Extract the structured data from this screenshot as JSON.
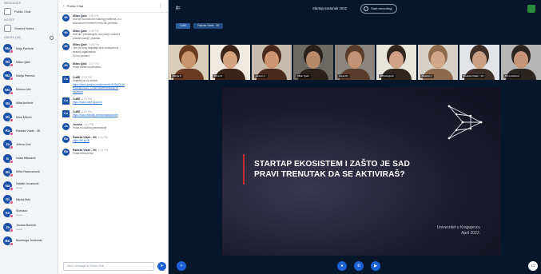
{
  "left_panel": {
    "section_messages": "MESSAGES",
    "public_chat_label": "Public Chat",
    "section_notes": "NOTES",
    "shared_notes_label": "Shared Notes",
    "section_users": "USERS (48)",
    "users": [
      {
        "initials": "Ma",
        "name": "Maja Pavlović",
        "sub": ""
      },
      {
        "initials": "Mi",
        "name": "Milan Qalić",
        "sub": ""
      },
      {
        "initials": "Ma",
        "name": "Marija Petrović",
        "sub": ""
      },
      {
        "initials": "Mo",
        "name": "Monica Lilić",
        "sub": ""
      },
      {
        "initials": "Mi",
        "name": "Mitra Ančević",
        "sub": ""
      },
      {
        "initials": "Mi",
        "name": "Mina Milović",
        "sub": ""
      },
      {
        "initials": "Ra",
        "name": "Radoša Vlade - 3N",
        "sub": ""
      },
      {
        "initials": "Ja",
        "name": "Jelena Cirić",
        "sub": ""
      },
      {
        "initials": "Iv",
        "name": "Ivana Milosavić",
        "sub": ""
      },
      {
        "initials": "Mi",
        "name": "Milos Radovanović",
        "sub": ""
      },
      {
        "initials": "Na",
        "name": "Nataša Jovanović",
        "sub": "Guest"
      },
      {
        "initials": "Ni",
        "name": "Nikola Ilivić",
        "sub": ""
      },
      {
        "initials": "Sn",
        "name": "Snežana",
        "sub": "Guest"
      },
      {
        "initials": "Je",
        "name": "Jovana Božović",
        "sub": "Guest"
      },
      {
        "initials": "Bo",
        "name": "Bozesuga Jovanović",
        "sub": ""
      }
    ]
  },
  "chat": {
    "title": "Public Chat",
    "menu_icon": "kebab-menu-icon",
    "messages": [
      {
        "initials": "Mi",
        "author": "Milan Qalić",
        "time": "3:06 PM",
        "lines": [
          "Ušli ste kod nas bez ikakvog problema, a u",
          "slobodnom momentu ćemo se povezati."
        ],
        "links": []
      },
      {
        "initials": "Mi",
        "author": "Milan Qalić",
        "time": "3:06 PM",
        "lines": [
          "Ušli ste i prisustvujete ovoj sesiji, hvala za",
          "prisustvovanje i podršku."
        ],
        "links": []
      },
      {
        "initials": "Mi",
        "author": "Milan Qalić",
        "time": "3:06 PM",
        "lines": [
          "Link sa ovog događaja biće dostupan na",
          "stranici organizatora.",
          "Svi su pozvani."
        ],
        "links": []
      },
      {
        "initials": "Mi",
        "author": "Milan Qalić",
        "time": "3:07 PM",
        "lines": [
          "Hvala svima na prisustvu."
        ],
        "links": []
      },
      {
        "initials": "Cu",
        "author": "CuBE",
        "time": "3:08 PM",
        "lines": [
          "Prijavite se za učešće:"
        ],
        "links": [
          "https://docs.google.com/forms/d/e/1FAIpQLSd",
          "fKs3Hy6XhAlJ_LTqwPa3Mb9uNvKBpY8",
          "viewform"
        ]
      },
      {
        "initials": "Cu",
        "author": "CuBE",
        "time": "3:09 PM",
        "lines": [],
        "links": [
          "https://www.cube.kg.ac.rs/"
        ]
      },
      {
        "initials": "Cu",
        "author": "CuBE",
        "time": "3:09 PM",
        "lines": [],
        "links": [
          "https://www.linkedin.com/company/cube"
        ]
      },
      {
        "initials": "Ja",
        "author": "Jovana",
        "time": "3:11 PM",
        "lines": [
          "Hvala na odličnoj prezentaciji!"
        ],
        "links": []
      },
      {
        "initials": "Ra",
        "author": "Radoša Vlade - 3N",
        "time": "3:11 PM",
        "lines": [],
        "links": [
          "https://bit.ly/3N"
        ]
      },
      {
        "initials": "Ra",
        "author": "Radoša Vlade - 3N",
        "time": "3:12 PM",
        "lines": [
          "Hvala svima puno!"
        ],
        "links": []
      }
    ],
    "input_placeholder": "Send message to Public Chat",
    "send_icon": "send-icon"
  },
  "main": {
    "meeting_title": "Startap sastanak 2022",
    "record_label": "Start recording",
    "pills": [
      "CuBE",
      "Radoša Vlade - 3N"
    ],
    "participants": [
      {
        "name": "Marija P.",
        "face": "#c9956f",
        "hair": "#6b3a22",
        "bg": "#d9cdb8"
      },
      {
        "name": "Mina M.",
        "face": "#d4a480",
        "hair": "#3a2418",
        "bg": "#efe9e2"
      },
      {
        "name": "Jelena C.",
        "face": "#cc9573",
        "hair": "#4a2a1c",
        "bg": "#c7bcae"
      },
      {
        "name": "Milan Qalić",
        "face": "#b78a6a",
        "hair": "#2a211c",
        "bg": "#6d6a66"
      },
      {
        "name": "Ivana M.",
        "face": "#c29475",
        "hair": "#5a3c2a",
        "bg": "#8b8780"
      },
      {
        "name": "Milosavljević",
        "face": "#d0a186",
        "hair": "#31261f",
        "bg": "#e7e4dc"
      },
      {
        "name": "Nataša J.",
        "face": "#d1a78b",
        "hair": "#8d6a4d",
        "bg": "#d5d0c8"
      },
      {
        "name": "Radoša Vlade - 3N",
        "face": "#c9a083",
        "hair": "#3d2f27",
        "bg": "#e2e3e6"
      },
      {
        "name": "Mina Radović",
        "face": "#c69578",
        "hair": "#2b2522",
        "bg": "#b6b5b5"
      }
    ],
    "slide": {
      "title_line1": "STARTAP EKOSISTEM I ZAŠTO JE SAD",
      "title_line2": "PRAVI TRENUTAK DA SE AKTIVIRAŠ?",
      "university": "Univerzitet u Kragujevcu",
      "date": "April 2022."
    },
    "bottom_actions": [
      "plus-icon",
      "mic-icon",
      "phone-icon",
      "video-icon",
      "presentation-icon"
    ]
  }
}
